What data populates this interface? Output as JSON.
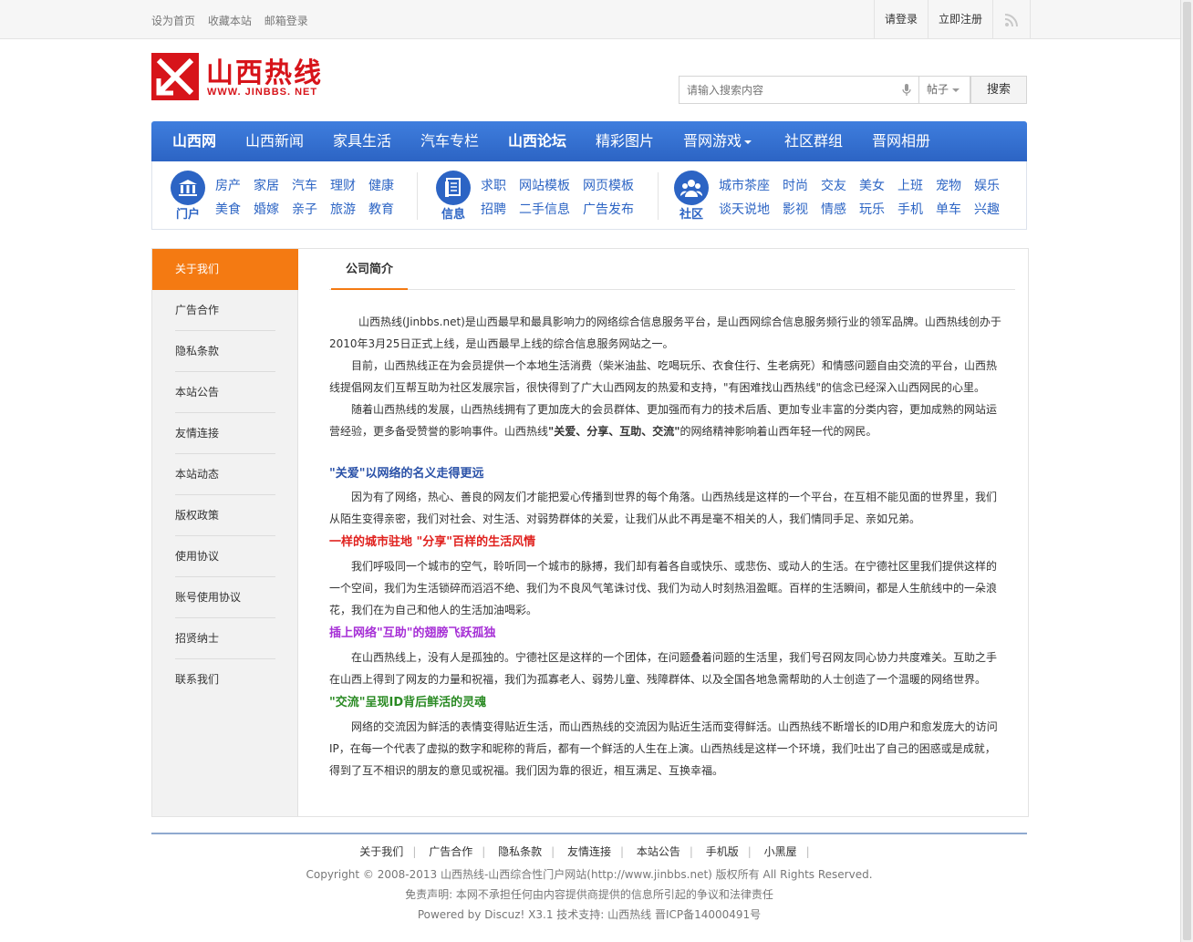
{
  "topbar": {
    "links": [
      "设为首页",
      "收藏本站",
      "邮箱登录"
    ],
    "login": "请登录",
    "register": "立即注册"
  },
  "logo": {
    "name": "山西热线",
    "url": "WWW. JINBBS. NET"
  },
  "search": {
    "placeholder": "请输入搜索内容",
    "type": "帖子",
    "button": "搜索"
  },
  "nav": {
    "items": [
      "山西网",
      "山西新闻",
      "家具生活",
      "汽车专栏",
      "山西论坛",
      "精彩图片",
      "晋网游戏",
      "社区群组",
      "晋网相册"
    ]
  },
  "subnav": {
    "portal": {
      "label": "门户",
      "row1": [
        "房产",
        "家居",
        "汽车",
        "理财",
        "健康"
      ],
      "row2": [
        "美食",
        "婚嫁",
        "亲子",
        "旅游",
        "教育"
      ]
    },
    "info": {
      "label": "信息",
      "row1": [
        "求职",
        "网站模板",
        "网页模板"
      ],
      "row2": [
        "招聘",
        "二手信息",
        "广告发布"
      ]
    },
    "community": {
      "label": "社区",
      "row1": [
        "城市茶座",
        "时尚",
        "交友",
        "美女",
        "上班",
        "宠物",
        "娱乐"
      ],
      "row2": [
        "谈天说地",
        "影视",
        "情感",
        "玩乐",
        "手机",
        "单车",
        "兴趣"
      ]
    }
  },
  "sidebar": {
    "items": [
      "关于我们",
      "广告合作",
      "隐私条款",
      "本站公告",
      "友情连接",
      "本站动态",
      "版权政策",
      "使用协议",
      "账号使用协议",
      "招贤纳士",
      "联系我们"
    ]
  },
  "content": {
    "tab": "公司简介",
    "p1": "山西热线(Jinbbs.net)是山西最早和最具影响力的网络综合信息服务平台，是山西网综合信息服务频行业的领军品牌。山西热线创办于2010年3月25日正式上线，是山西最早上线的综合信息服务网站之一。",
    "p2": "目前，山西热线正在为会员提供一个本地生活消费（柴米油盐、吃喝玩乐、衣食住行、生老病死）和情感问题自由交流的平台，山西热线提倡网友们互帮互助为社区发展宗旨，很快得到了广大山西网友的热爱和支持，\"有困难找山西热线\"的信念已经深入山西网民的心里。",
    "p3a": "随着山西热线的发展，山西热线拥有了更加庞大的会员群体、更加强而有力的技术后盾、更加专业丰富的分类内容，更加成熟的网站运营经验，更多备受赞誉的影响事件。山西热线",
    "p3b": "\"关爱、分享、互助、交流\"",
    "p3c": "的网络精神影响着山西年轻一代的网民。",
    "h1": "\"关爱\"以网络的名义走得更远",
    "p4": "因为有了网络，热心、善良的网友们才能把爱心传播到世界的每个角落。山西热线是这样的一个平台，在互相不能见面的世界里，我们从陌生变得亲密，我们对社会、对生活、对弱势群体的关爱，让我们从此不再是毫不相关的人，我们情同手足、亲如兄弟。",
    "h2": "一样的城市驻地 \"分享\"百样的生活风情",
    "p5": "我们呼吸同一个城市的空气，聆听同一个城市的脉搏，我们却有着各自或快乐、或悲伤、或动人的生活。在宁德社区里我们提供这样的一个空间，我们为生活锁碎而滔滔不绝、我们为不良风气笔诛讨伐、我们为动人时刻热泪盈眶。百样的生活瞬间，都是人生航线中的一朵浪花，我们在为自己和他人的生活加油喝彩。",
    "h3": "插上网络\"互助\"的翅膀飞跃孤独",
    "p6": "在山西热线上，没有人是孤独的。宁德社区是这样的一个团体，在问题叠着问题的生活里，我们号召网友同心协力共度难关。互助之手在山西上得到了网友的力量和祝福，我们为孤寡老人、弱势儿童、残障群体、以及全国各地急需帮助的人士创造了一个温暖的网络世界。",
    "h4": "\"交流\"呈现ID背后鲜活的灵魂",
    "p7": "网络的交流因为鲜活的表情变得贴近生活，而山西热线的交流因为贴近生活而变得鲜活。山西热线不断增长的ID用户和愈发庞大的访问IP，在每一个代表了虚拟的数字和昵称的背后，都有一个鲜活的人生在上演。山西热线是这样一个环境，我们吐出了自己的困惑或是成就，得到了互不相识的朋友的意见或祝福。我们因为靠的很近，相互满足、互换幸福。"
  },
  "footer": {
    "links": [
      "关于我们",
      "广告合作",
      "隐私条款",
      "友情连接",
      "本站公告",
      "手机版",
      "小黑屋"
    ],
    "copyright": "Copyright © 2008-2013 山西热线-山西综合性门户网站(http://www.jinbbs.net) 版权所有 All Rights Reserved.",
    "disclaimer": "免责声明: 本网不承担任何由内容提供商提供的信息所引起的争议和法律责任",
    "powered": "Powered by Discuz! X3.1  技术支持: 山西热线 晋ICP备14000491号"
  },
  "colors": {
    "nav": "#2c64c4",
    "accent": "#f47a12",
    "brand": "#d7141a"
  }
}
